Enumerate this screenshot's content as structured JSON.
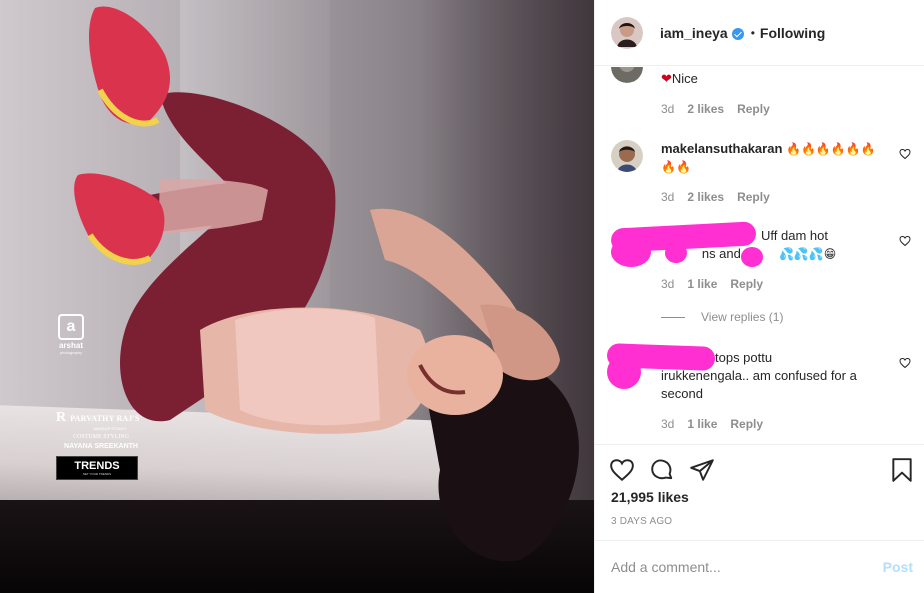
{
  "post": {
    "username": "iam_ineya",
    "follow_label": "Following",
    "separator": "•"
  },
  "photo": {
    "logo_letter": "a",
    "logo_name": "arshat",
    "logo_sub": "photography",
    "makeup_initials": "R",
    "makeup_name": "PARVATHY RAJ'S",
    "makeup_studio": "MAKEUP STUDIO",
    "styling_label": "COSTUME STYLING",
    "stylist": "NAYANA SREEKANTH",
    "brand": "TRENDS",
    "brand_sub": "SET YOUR TRENDS"
  },
  "comments": [
    {
      "username": "",
      "text": "Nice",
      "time": "3d",
      "likes": "2 likes",
      "reply": "Reply"
    },
    {
      "username": "makelansuthakaran",
      "text": "🔥🔥🔥🔥🔥🔥🔥🔥",
      "time": "3d",
      "likes": "2 likes",
      "reply": "Reply"
    },
    {
      "username": "",
      "text_line1": "Uff dam hot",
      "text_line2a": "m",
      "text_line2b": "ns and.. a",
      "text_line2c": "💦💦💦😁",
      "time": "3d",
      "likes": "1 like",
      "reply": "Reply"
    },
    {
      "username": "",
      "text_line1": "tops pottu",
      "text_rest": "irukkenengala.. am confused for a second",
      "time": "3d",
      "likes": "1 like",
      "reply": "Reply"
    }
  ],
  "view_replies": "View replies (1)",
  "likes_count": "21,995 likes",
  "posted_ago": "3 DAYS AGO",
  "add_comment_placeholder": "Add a comment...",
  "post_label": "Post",
  "colors": {
    "redaction": "#ff2fd2",
    "verified": "#3897f0",
    "heart": "#ed4956",
    "post_disabled": "#b2dffc"
  }
}
